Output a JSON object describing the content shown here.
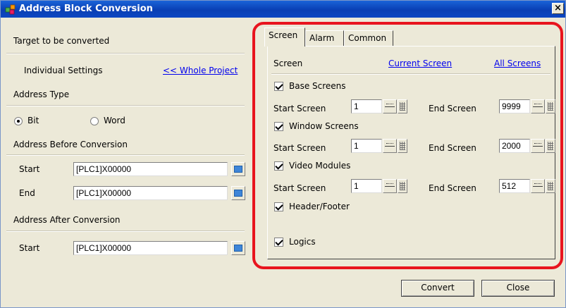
{
  "window": {
    "title": "Address Block Conversion",
    "close_glyph": "×"
  },
  "left": {
    "target_label": "Target to be converted",
    "individual_settings": "Individual Settings",
    "whole_project_link": "<< Whole Project",
    "address_type_label": "Address Type",
    "radio_bit": "Bit",
    "radio_word": "Word",
    "selected_type": "Bit",
    "before_label": "Address Before Conversion",
    "start_label": "Start",
    "start_value": "[PLC1]X00000",
    "end_label": "End",
    "end_value": "[PLC1]X00000",
    "after_label": "Address After Conversion",
    "after_start_label": "Start",
    "after_start_value": "[PLC1]X00000"
  },
  "tabs": [
    {
      "label": "Screen",
      "active": true
    },
    {
      "label": "Alarm",
      "active": false
    },
    {
      "label": "Common",
      "active": false
    }
  ],
  "screen_tab": {
    "heading": "Screen",
    "current_screen_link": "Current Screen",
    "all_screens_link": "All Screens",
    "base": {
      "label": "Base Screens",
      "checked": true,
      "start_label": "Start Screen",
      "start_value": "1",
      "end_label": "End Screen",
      "end_value": "9999"
    },
    "window": {
      "label": "Window Screens",
      "checked": true,
      "start_label": "Start Screen",
      "start_value": "1",
      "end_label": "End Screen",
      "end_value": "2000"
    },
    "video": {
      "label": "Video Modules",
      "checked": true,
      "start_label": "Start Screen",
      "start_value": "1",
      "end_label": "End Screen",
      "end_value": "512"
    },
    "header_footer": {
      "label": "Header/Footer",
      "checked": true
    },
    "logics": {
      "label": "Logics",
      "checked": true
    }
  },
  "buttons": {
    "convert": "Convert",
    "close": "Close"
  },
  "colors": {
    "highlight": "#e8141e",
    "title_bar": "#0a3fb4",
    "link": "#0000ee"
  }
}
